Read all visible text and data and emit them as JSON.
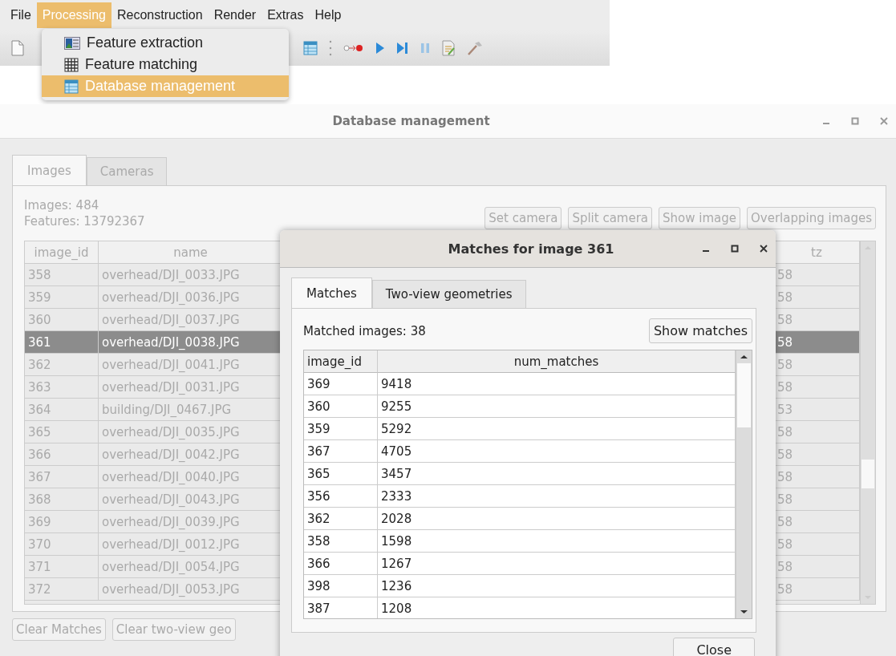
{
  "menu_bar": [
    {
      "label": "File",
      "selected": false
    },
    {
      "label": "Processing",
      "selected": true
    },
    {
      "label": "Reconstruction",
      "selected": false
    },
    {
      "label": "Render",
      "selected": false
    },
    {
      "label": "Extras",
      "selected": false
    },
    {
      "label": "Help",
      "selected": false
    }
  ],
  "dropdown": [
    {
      "label": "Feature extraction",
      "selected": false
    },
    {
      "label": "Feature matching",
      "selected": false
    },
    {
      "label": "Database management",
      "selected": true
    }
  ],
  "db_window": {
    "title": "Database management",
    "tabs": [
      {
        "label": "Images",
        "selected": true
      },
      {
        "label": "Cameras",
        "selected": false
      }
    ],
    "images_count": "Images: 484",
    "features_count": "Features: 13792367",
    "buttons": [
      "Set camera",
      "Split camera",
      "Show image",
      "Overlapping images"
    ],
    "table": {
      "columns": [
        "image_id",
        "name",
        "tz"
      ],
      "rows": [
        {
          "image_id": "358",
          "name": "overhead/DJI_0033.JPG",
          "tz": "58",
          "selected": false
        },
        {
          "image_id": "359",
          "name": "overhead/DJI_0036.JPG",
          "tz": "58",
          "selected": false
        },
        {
          "image_id": "360",
          "name": "overhead/DJI_0037.JPG",
          "tz": "58",
          "selected": false
        },
        {
          "image_id": "361",
          "name": "overhead/DJI_0038.JPG",
          "tz": "58",
          "selected": true
        },
        {
          "image_id": "362",
          "name": "overhead/DJI_0041.JPG",
          "tz": "58",
          "selected": false
        },
        {
          "image_id": "363",
          "name": "overhead/DJI_0031.JPG",
          "tz": "58",
          "selected": false
        },
        {
          "image_id": "364",
          "name": "building/DJI_0467.JPG",
          "tz": "53",
          "selected": false
        },
        {
          "image_id": "365",
          "name": "overhead/DJI_0035.JPG",
          "tz": "58",
          "selected": false
        },
        {
          "image_id": "366",
          "name": "overhead/DJI_0042.JPG",
          "tz": "58",
          "selected": false
        },
        {
          "image_id": "367",
          "name": "overhead/DJI_0040.JPG",
          "tz": "58",
          "selected": false
        },
        {
          "image_id": "368",
          "name": "overhead/DJI_0043.JPG",
          "tz": "58",
          "selected": false
        },
        {
          "image_id": "369",
          "name": "overhead/DJI_0039.JPG",
          "tz": "58",
          "selected": false
        },
        {
          "image_id": "370",
          "name": "overhead/DJI_0012.JPG",
          "tz": "58",
          "selected": false
        },
        {
          "image_id": "371",
          "name": "overhead/DJI_0054.JPG",
          "tz": "58",
          "selected": false
        },
        {
          "image_id": "372",
          "name": "overhead/DJI_0053.JPG",
          "tz": "58",
          "selected": false
        }
      ]
    },
    "bottom_buttons": [
      "Clear Matches",
      "Clear two-view geo"
    ]
  },
  "dialog": {
    "title": "Matches for image 361",
    "tabs": [
      {
        "label": "Matches",
        "selected": true
      },
      {
        "label": "Two-view geometries",
        "selected": false
      }
    ],
    "matched_count": "Matched images: 38",
    "show_button": "Show matches",
    "table": {
      "columns": [
        "image_id",
        "num_matches"
      ],
      "rows": [
        [
          "369",
          "9418"
        ],
        [
          "360",
          "9255"
        ],
        [
          "359",
          "5292"
        ],
        [
          "367",
          "4705"
        ],
        [
          "365",
          "3457"
        ],
        [
          "356",
          "2333"
        ],
        [
          "362",
          "2028"
        ],
        [
          "358",
          "1598"
        ],
        [
          "366",
          "1267"
        ],
        [
          "398",
          "1236"
        ],
        [
          "387",
          "1208"
        ]
      ]
    },
    "close_button": "Close"
  }
}
